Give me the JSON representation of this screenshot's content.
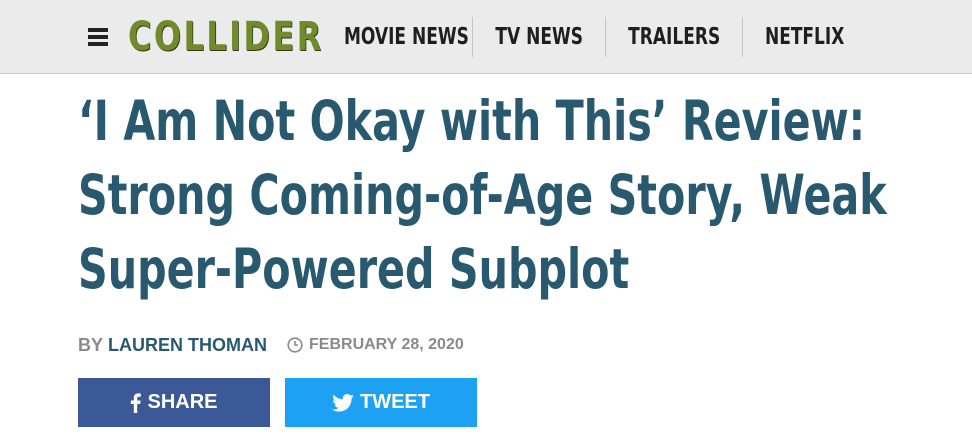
{
  "header": {
    "logo": "COLLIDER",
    "menu_icon": "hamburger-menu-icon",
    "nav": [
      {
        "label": "MOVIE NEWS"
      },
      {
        "label": "TV NEWS"
      },
      {
        "label": "TRAILERS"
      },
      {
        "label": "NETFLIX"
      }
    ],
    "colors": {
      "background": "#ebebeb",
      "logo": "#6f8b2c"
    }
  },
  "article": {
    "title": "‘I Am Not Okay with This’ Review: Strong Coming-of-Age Story, Weak Super-Powered Subplot",
    "byline_prefix": "BY",
    "author": "LAUREN THOMAN",
    "date_icon": "clock-icon",
    "date": "FEBRUARY 28, 2020",
    "colors": {
      "title": "#28596e",
      "meta": "#8a8a8a"
    }
  },
  "share": {
    "facebook": {
      "label": "SHARE",
      "icon": "facebook-icon",
      "color": "#3b5997"
    },
    "twitter": {
      "label": "TWEET",
      "icon": "twitter-icon",
      "color": "#1da1f2"
    }
  }
}
